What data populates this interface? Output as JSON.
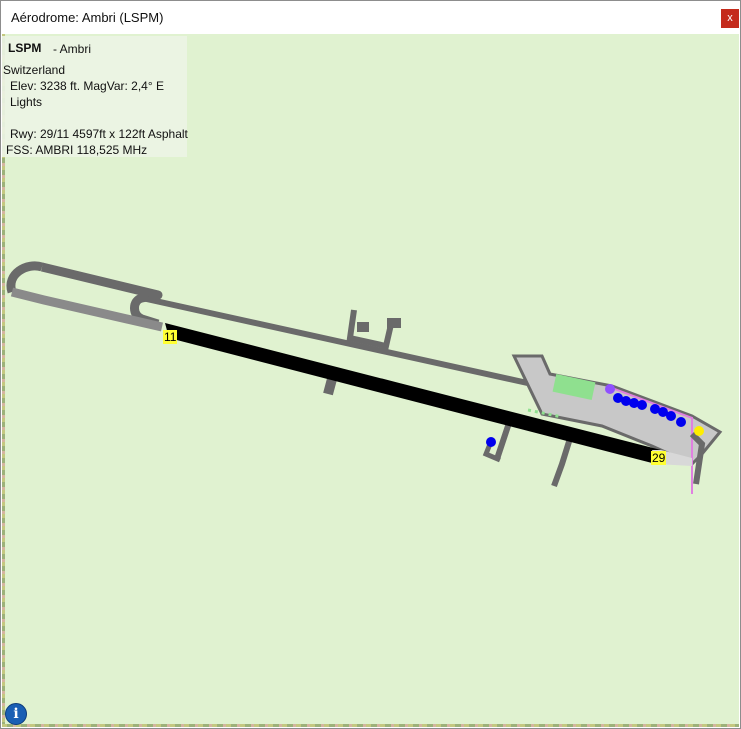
{
  "window": {
    "title": "Aérodrome: Ambri (LSPM)",
    "close_label": "x"
  },
  "airport": {
    "icao": "LSPM",
    "name": "- Ambri",
    "country": "Switzerland",
    "elevation": "Elev: 3238 ft. MagVar: 2,4° E",
    "lights": "Lights",
    "runway": "Rwy: 29/11 4597ft x 122ft Asphalt",
    "fss": "FSS: AMBRI 118,525 MHz"
  },
  "runway_labels": {
    "rwy_11": "11",
    "rwy_29": "29"
  },
  "info_button_label": "i",
  "colors": {
    "map_background": "#e0f2d0",
    "runway": "#000000",
    "taxiway": "#666666",
    "parking_spot": "#0000ee",
    "label_bg": "#ffff33"
  },
  "icons": {
    "close": "close-icon",
    "info": "info-icon"
  }
}
